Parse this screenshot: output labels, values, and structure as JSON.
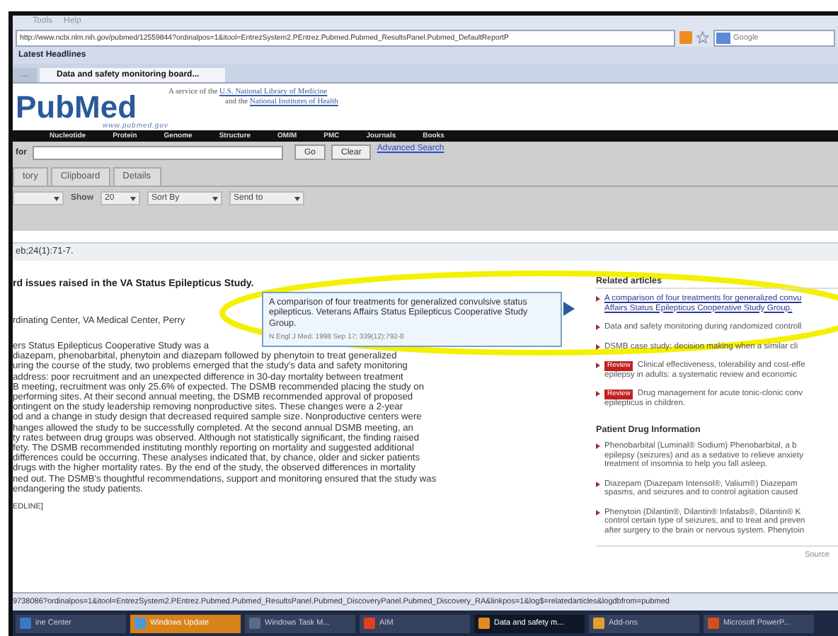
{
  "browser": {
    "menu": [
      "Tools",
      "Help"
    ],
    "address": "http://www.ncbi.nlm.nih.gov/pubmed/12559844?ordinalpos=1&itool=EntrezSystem2.PEntrez.Pubmed.Pubmed_ResultsPanel.Pubmed_DefaultReportP",
    "search_placeholder": "Google",
    "bookmark": "Latest Headlines",
    "tabs": [
      {
        "label": "...",
        "selected": false
      },
      {
        "label": "Data and safety monitoring board...",
        "selected": true
      }
    ]
  },
  "header": {
    "logo": "PubMed",
    "logo_url": "www.pubmed.gov",
    "service_prefix": "A service of the",
    "service_link": "U.S. National Library of Medicine",
    "and_prefix": "and the",
    "and_link": "National Institutes of Health"
  },
  "nav": [
    "Nucleotide",
    "Protein",
    "Genome",
    "Structure",
    "OMIM",
    "PMC",
    "Journals",
    "Books"
  ],
  "search": {
    "label": "for",
    "go": "Go",
    "clear": "Clear",
    "advanced": "Advanced Search"
  },
  "tabs": [
    {
      "label": "tory",
      "selected": false
    },
    {
      "label": "Clipboard",
      "selected": false
    },
    {
      "label": "Details",
      "selected": false
    }
  ],
  "toolbar": {
    "show_label": "Show",
    "show_value": "20",
    "sort": "Sort By",
    "send": "Send to"
  },
  "citation": "eb;24(1):71-7.",
  "title": "rd issues raised in the VA Status Epilepticus Study.",
  "affiliation": "rdinating Center, VA Medical Center, Perry",
  "abstract": [
    "ers Status Epilepticus Cooperative Study was a",
    "diazepam, phenobarbital, phenytoin and diazepam followed by phenytoin to treat generalized",
    "uring the course of the study, two problems emerged that the study's data and safety monitoring",
    "address: poor recruitment and an unexpected difference in 30-day mortality between treatment",
    "B meeting, recruitment was only 25.6% of expected. The DSMB recommended placing the study on",
    "performing sites. At their second annual meeting, the DSMB recommended approval of proposed",
    "ontingent on the study leadership removing nonproductive sites. These changes were a 2-year",
    "od and a change in study design that decreased required sample size. Nonproductive centers were",
    "hanges allowed the study to be successfully completed. At the second annual DSMB meeting, an",
    "ty rates between drug groups was observed. Although not statistically significant, the finding raised",
    "fety. The DSMB recommended instituting monthly reporting on mortality and suggested additional",
    "differences could be occurring. These analyses indicated that, by chance, older and sicker patients",
    "drugs with the higher mortality rates. By the end of the study, the observed differences in mortality",
    "ned out. The DSMB's thoughtful recommendations, support and monitoring ensured that the study was",
    "endangering the study patients."
  ],
  "source_tag": "EDLINE]",
  "tooltip": {
    "text": "A comparison of four treatments for generalized convulsive status epilepticus. Veterans Affairs Status Epilepticus Cooperative Study Group.",
    "citation": "N Engl J Med. 1998 Sep 17; 339(12):792-8"
  },
  "related": {
    "heading": "Related articles",
    "items": [
      {
        "lines": [
          "A comparison of four treatments for generalized convu",
          "Affairs Status Epilepticus Cooperative Study Group."
        ],
        "kind": "link"
      },
      {
        "lines": [
          "Data and safety monitoring during randomized controll"
        ],
        "kind": "plain"
      },
      {
        "lines": [
          "DSMB case study: decision making when a similar cli"
        ],
        "kind": "plain"
      },
      {
        "badge": "Review",
        "lines": [
          "Clinical effectiveness, tolerability and cost-effe",
          "epilepsy in adults: a systematic review and economic"
        ],
        "kind": "review"
      },
      {
        "badge": "Review",
        "lines": [
          "Drug management for acute tonic-clonic conv",
          "epilepticus in children."
        ],
        "kind": "review"
      }
    ]
  },
  "drugs": {
    "heading": "Patient Drug Information",
    "items": [
      [
        "Phenobarbital (Luminal® Sodium)  Phenobarbital, a b",
        "epilepsy (seizures) and as a sedative to relieve anxiety",
        "treatment of insomnia to help you fall asleep."
      ],
      [
        "Diazepam (Diazepam Intensol®, Valium®)  Diazepam",
        "spasms, and seizures and to control agitation caused"
      ],
      [
        "Phenytoin (Dilantin®, Dilantin® Infatabs®, Dilantin® K",
        "control certain type of seizures, and to treat and preven",
        "after surgery to the brain or nervous system. Phenytoin"
      ]
    ],
    "source": "Source"
  },
  "status_bar": "9738086?ordinalpos=1&itool=EntrezSystem2.PEntrez.Pubmed.Pubmed_ResultsPanel.Pubmed_DiscoveryPanel.Pubmed_Discovery_RA&linkpos=1&log$=relatedarticles&logdbfrom=pubmed",
  "taskbar": [
    {
      "label": "ine Center",
      "selected": false,
      "highlighted": false,
      "color": "#3a78c8"
    },
    {
      "label": "Windows Update",
      "selected": false,
      "highlighted": true,
      "color": "#4a9ad8"
    },
    {
      "label": "Windows Task M...",
      "selected": false,
      "highlighted": false,
      "color": "#5a6a8a"
    },
    {
      "label": "AIM",
      "selected": false,
      "highlighted": false,
      "color": "#e04020"
    },
    {
      "label": "Data and safety m...",
      "selected": true,
      "highlighted": false,
      "color": "#e08a20"
    },
    {
      "label": "Add-ons",
      "selected": false,
      "highlighted": false,
      "color": "#e0a030"
    },
    {
      "label": "Microsoft PowerP...",
      "selected": false,
      "highlighted": false,
      "color": "#d05020"
    }
  ]
}
